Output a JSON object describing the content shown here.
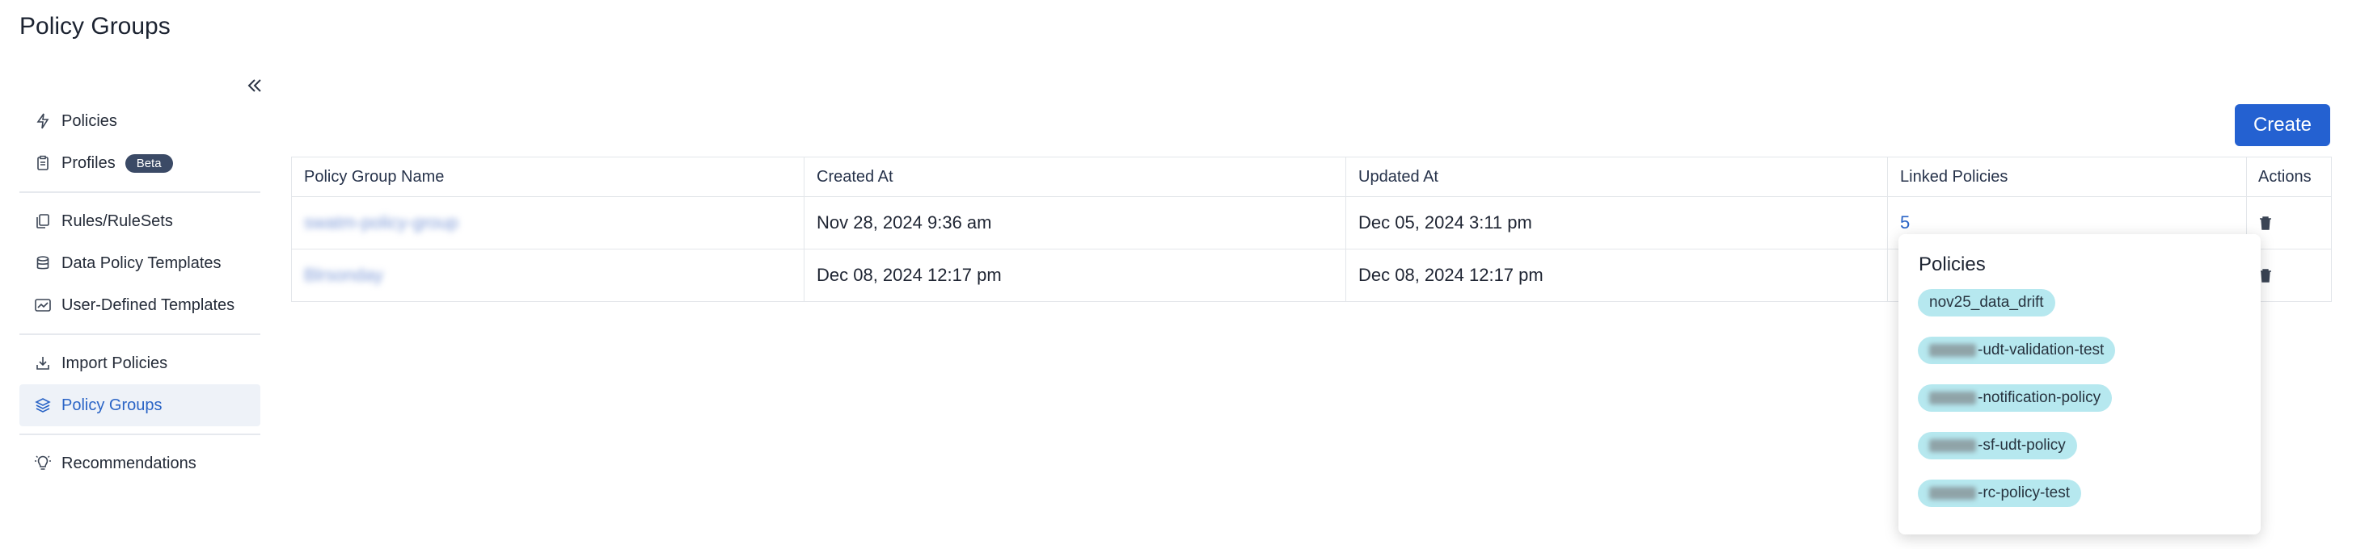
{
  "page": {
    "title": "Policy Groups"
  },
  "sidebar": {
    "items": [
      {
        "label": "Policies",
        "icon": "bolt-icon"
      },
      {
        "label": "Profiles",
        "icon": "clipboard-icon",
        "badge": "Beta"
      },
      {
        "label": "Rules/RuleSets",
        "icon": "copy-icon"
      },
      {
        "label": "Data Policy Templates",
        "icon": "database-icon"
      },
      {
        "label": "User-Defined Templates",
        "icon": "chart-template-icon"
      },
      {
        "label": "Import Policies",
        "icon": "import-icon"
      },
      {
        "label": "Policy Groups",
        "icon": "layers-icon",
        "active": true
      },
      {
        "label": "Recommendations",
        "icon": "lightbulb-icon"
      }
    ]
  },
  "toolbar": {
    "create_label": "Create"
  },
  "table": {
    "headers": [
      "Policy Group Name",
      "Created At",
      "Updated At",
      "Linked Policies",
      "Actions"
    ],
    "rows": [
      {
        "name": "swatm-policy-group",
        "created": "Nov 28, 2024 9:36 am",
        "updated": "Dec 05, 2024 3:11 pm",
        "linked": "5"
      },
      {
        "name": "Blrsonday",
        "created": "Dec 08, 2024 12:17 pm",
        "updated": "Dec 08, 2024 12:17 pm",
        "linked": ""
      }
    ]
  },
  "popover": {
    "title": "Policies",
    "items": [
      {
        "prefix": "",
        "text": "nov25_data_drift"
      },
      {
        "prefix": "redacted",
        "text": "-udt-validation-test"
      },
      {
        "prefix": "redacted",
        "text": "-notification-policy"
      },
      {
        "prefix": "redacted",
        "text": "-sf-udt-policy"
      },
      {
        "prefix": "redacted",
        "text": "-rc-policy-test"
      }
    ]
  },
  "colors": {
    "accent": "#2461d1",
    "pill": "#b6e8ef",
    "active_bg": "#eef2f8",
    "badge": "#3b4a66"
  }
}
